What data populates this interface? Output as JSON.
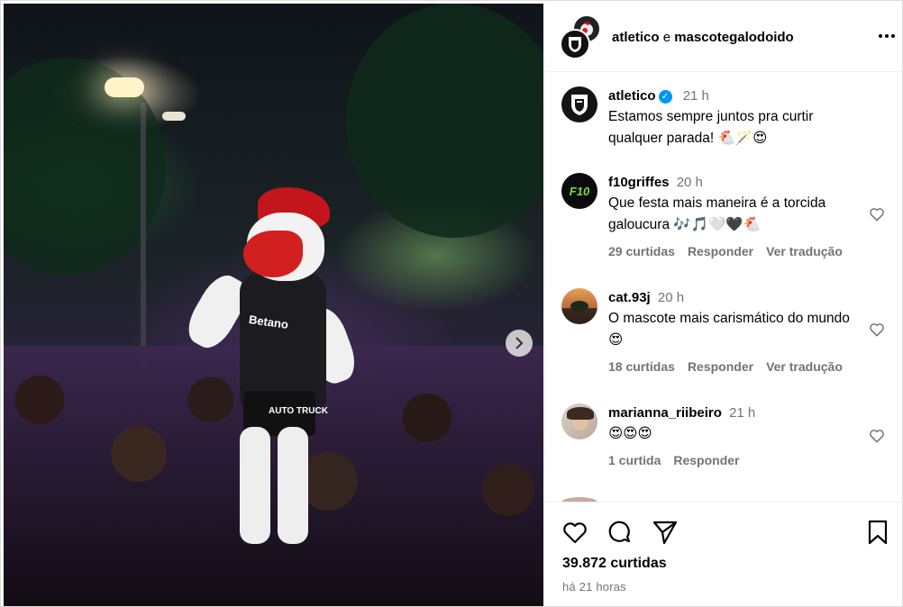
{
  "header": {
    "user1": "atletico",
    "conjunction": "e",
    "user2": "mascotegalodoido"
  },
  "photo": {
    "jersey_sponsor": "Betano",
    "shorts_text": "AUTO TRUCK"
  },
  "caption": {
    "username": "atletico",
    "verified": true,
    "time": "21 h",
    "text": "Estamos sempre juntos pra curtir qualquer parada! 🐔🪄😍"
  },
  "comments": [
    {
      "username": "f10griffes",
      "time": "20 h",
      "text": "Que festa mais maneira é a torcida galoucura 🎶🎵🤍🖤🐔",
      "likes": "29 curtidas",
      "reply": "Responder",
      "translate": "Ver tradução",
      "avatar_text": "F10"
    },
    {
      "username": "cat.93j",
      "time": "20 h",
      "text": "O mascote mais carismático do mundo 😍",
      "likes": "18 curtidas",
      "reply": "Responder",
      "translate": "Ver tradução"
    },
    {
      "username": "marianna_riibeiro",
      "time": "21 h",
      "text": "😍😍😍",
      "likes": "1 curtida",
      "reply": "Responder"
    }
  ],
  "footer": {
    "likes": "39.872 curtidas",
    "time_ago": "há 21 horas"
  },
  "icons": {
    "like": "heart-icon",
    "comment": "comment-icon",
    "share": "share-icon",
    "save": "bookmark-icon",
    "more": "more-icon",
    "next": "chevron-right-icon"
  },
  "colors": {
    "verified": "#0095f6",
    "secondary_text": "#737373",
    "border": "#dbdbdb"
  }
}
